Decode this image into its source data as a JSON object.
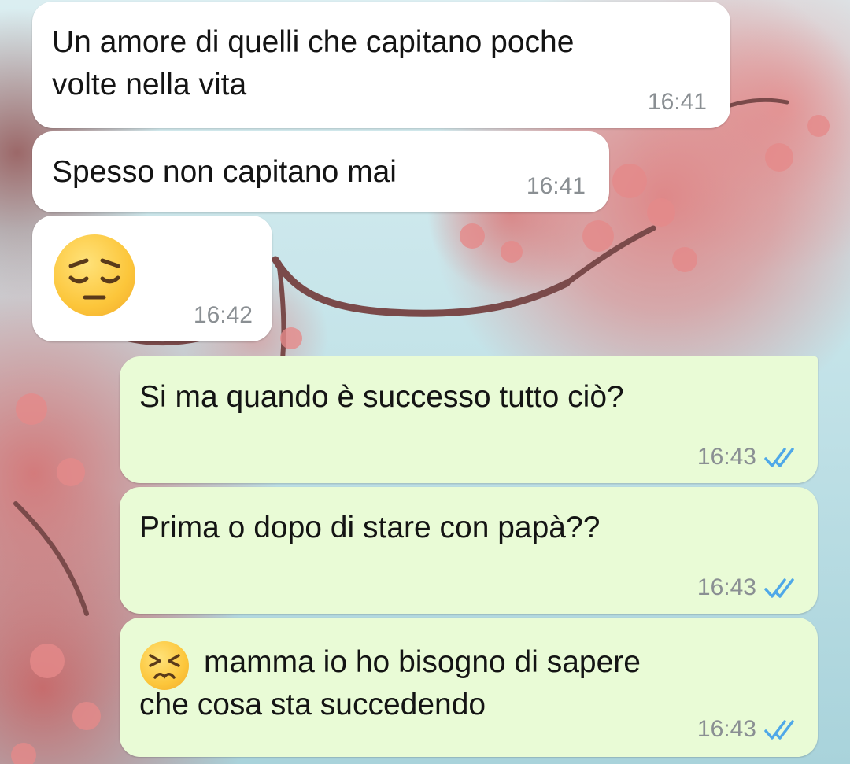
{
  "chat": {
    "messages": [
      {
        "direction": "incoming",
        "text": "Un amore di quelli che capitano poche\nvolte nella vita",
        "time": "16:41"
      },
      {
        "direction": "incoming",
        "text": "Spesso non capitano mai",
        "time": "16:41"
      },
      {
        "direction": "incoming",
        "emoji": "pensive-face",
        "time": "16:42"
      },
      {
        "direction": "outgoing",
        "text": "Si ma quando è successo tutto ciò?",
        "time": "16:43",
        "status": "read"
      },
      {
        "direction": "outgoing",
        "text": "Prima o dopo di stare con papà??",
        "time": "16:43",
        "status": "read"
      },
      {
        "direction": "outgoing",
        "emoji": "persevering-face",
        "text": "mamma io ho bisogno di sapere\nche cosa sta succedendo",
        "time": "16:43",
        "status": "read"
      }
    ]
  },
  "colors": {
    "incoming_bubble": "#ffffff",
    "outgoing_bubble": "#e9fbd6",
    "read_tick": "#4fa8e8",
    "timestamp": "#8a8f93"
  },
  "icons": {
    "read_receipt": "double-check-icon"
  }
}
